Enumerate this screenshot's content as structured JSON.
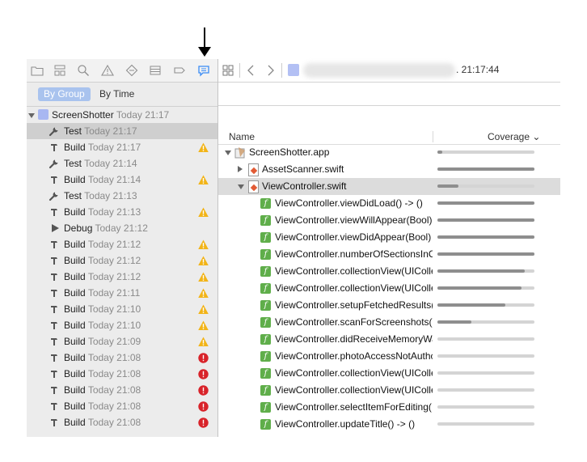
{
  "nav_toolbar": {
    "icons": [
      "folder-icon",
      "hierarchy-icon",
      "search-icon",
      "warning-icon",
      "diamond-icon",
      "list-icon",
      "label-icon",
      "report-icon"
    ]
  },
  "scope": {
    "by_group": "By Group",
    "by_time": "By Time"
  },
  "project": {
    "name": "ScreenShotter",
    "time": "Today 21:17"
  },
  "actions": [
    {
      "type": "test",
      "label": "Test",
      "time": "Today 21:17",
      "status": "none",
      "selected": true
    },
    {
      "type": "build",
      "label": "Build",
      "time": "Today 21:17",
      "status": "warning"
    },
    {
      "type": "test",
      "label": "Test",
      "time": "Today 21:14",
      "status": "none"
    },
    {
      "type": "build",
      "label": "Build",
      "time": "Today 21:14",
      "status": "warning"
    },
    {
      "type": "test",
      "label": "Test",
      "time": "Today 21:13",
      "status": "none"
    },
    {
      "type": "build",
      "label": "Build",
      "time": "Today 21:13",
      "status": "warning"
    },
    {
      "type": "debug",
      "label": "Debug",
      "time": "Today 21:12",
      "status": "none"
    },
    {
      "type": "build",
      "label": "Build",
      "time": "Today 21:12",
      "status": "warning"
    },
    {
      "type": "build",
      "label": "Build",
      "time": "Today 21:12",
      "status": "warning"
    },
    {
      "type": "build",
      "label": "Build",
      "time": "Today 21:12",
      "status": "warning"
    },
    {
      "type": "build",
      "label": "Build",
      "time": "Today 21:11",
      "status": "warning"
    },
    {
      "type": "build",
      "label": "Build",
      "time": "Today 21:10",
      "status": "warning"
    },
    {
      "type": "build",
      "label": "Build",
      "time": "Today 21:10",
      "status": "warning"
    },
    {
      "type": "build",
      "label": "Build",
      "time": "Today 21:09",
      "status": "warning"
    },
    {
      "type": "build",
      "label": "Build",
      "time": "Today 21:08",
      "status": "error"
    },
    {
      "type": "build",
      "label": "Build",
      "time": "Today 21:08",
      "status": "error"
    },
    {
      "type": "build",
      "label": "Build",
      "time": "Today 21:08",
      "status": "error"
    },
    {
      "type": "build",
      "label": "Build",
      "time": "Today 21:08",
      "status": "error"
    },
    {
      "type": "build",
      "label": "Build",
      "time": "Today 21:08",
      "status": "error"
    }
  ],
  "jump_bar": {
    "time": ". 21:17:44"
  },
  "table": {
    "col_name": "Name",
    "col_coverage": "Coverage ⌄"
  },
  "coverage": [
    {
      "level": 0,
      "kind": "app",
      "name": "ScreenShotter.app",
      "disclosure": "down",
      "fill": 0.05
    },
    {
      "level": 1,
      "kind": "file",
      "name": "AssetScanner.swift",
      "disclosure": "right",
      "fill": 1.0
    },
    {
      "level": 1,
      "kind": "file",
      "name": "ViewController.swift",
      "disclosure": "down",
      "fill": 0.22,
      "selected": true
    },
    {
      "level": 2,
      "kind": "func",
      "name": "ViewController.viewDidLoad() -> ()",
      "fill": 1.0
    },
    {
      "level": 2,
      "kind": "func",
      "name": "ViewController.viewWillAppear(Bool)",
      "fill": 1.0
    },
    {
      "level": 2,
      "kind": "func",
      "name": "ViewController.viewDidAppear(Bool) -",
      "fill": 1.0
    },
    {
      "level": 2,
      "kind": "func",
      "name": "ViewController.numberOfSectionsInC",
      "fill": 1.0
    },
    {
      "level": 2,
      "kind": "func",
      "name": "ViewController.collectionView(UIColle",
      "fill": 0.9
    },
    {
      "level": 2,
      "kind": "func",
      "name": "ViewController.collectionView(UIColle",
      "fill": 0.87
    },
    {
      "level": 2,
      "kind": "func",
      "name": "ViewController.setupFetchedResults(",
      "fill": 0.7
    },
    {
      "level": 2,
      "kind": "func",
      "name": "ViewController.scanForScreenshots()",
      "fill": 0.35
    },
    {
      "level": 2,
      "kind": "func",
      "name": "ViewController.didReceiveMemoryWa",
      "fill": 0.0
    },
    {
      "level": 2,
      "kind": "func",
      "name": "ViewController.photoAccessNotAuthc",
      "fill": 0.0
    },
    {
      "level": 2,
      "kind": "func",
      "name": "ViewController.collectionView(UIColle",
      "fill": 0.0
    },
    {
      "level": 2,
      "kind": "func",
      "name": "ViewController.collectionView(UIColle",
      "fill": 0.0
    },
    {
      "level": 2,
      "kind": "func",
      "name": "ViewController.selectItemForEditing(I",
      "fill": 0.0
    },
    {
      "level": 2,
      "kind": "func",
      "name": "ViewController.updateTitle() -> ()",
      "fill": 0.0
    }
  ],
  "colors": {
    "accent": "#a9c3ee",
    "warning": "#f2b418",
    "error": "#d8232a",
    "fn_green": "#5fae4a",
    "bar_fill": "#8e8e8e",
    "bar_track": "#d4d4d4"
  }
}
